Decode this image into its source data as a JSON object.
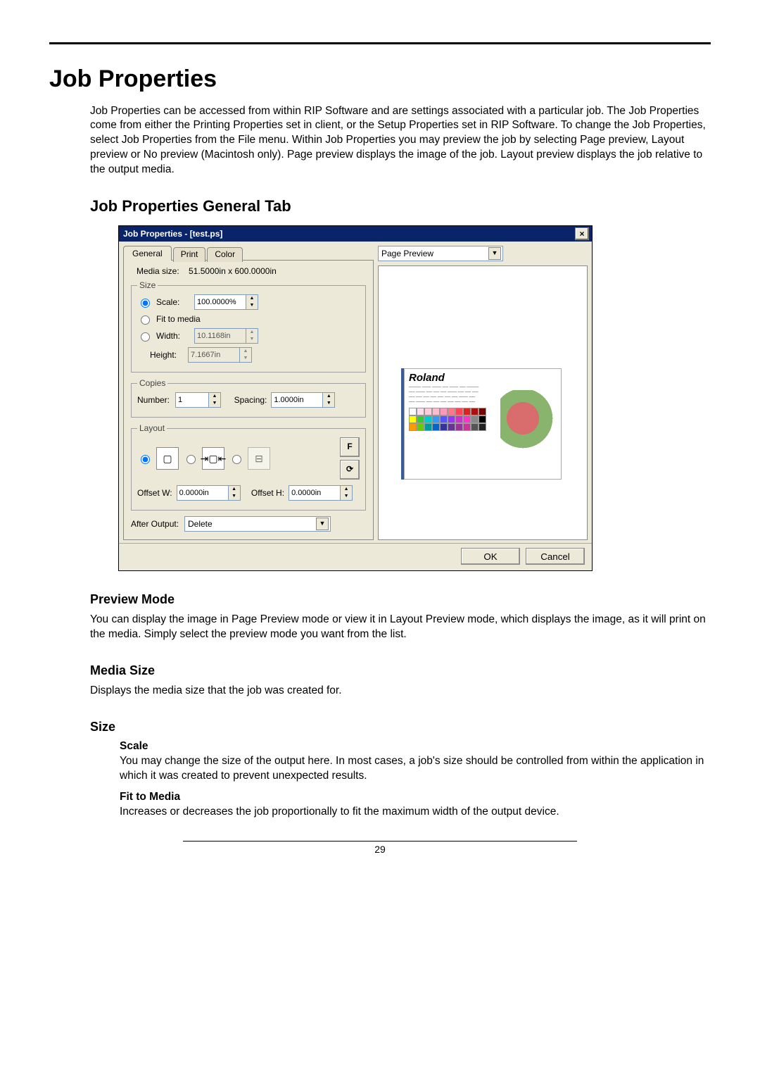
{
  "heading": "Job Properties",
  "intro": "Job Properties can be accessed from within RIP Software and are settings associated with a particular job. The Job Properties come from either the Printing Properties set in client, or the Setup Properties set in RIP Software. To change the Job Properties, select Job Properties from the File menu. Within Job Properties you may preview the job by selecting Page preview, Layout preview or No preview (Macintosh only). Page preview displays the image of the job. Layout preview displays the job relative to the output media.",
  "subheading": "Job Properties General Tab",
  "dialog": {
    "title": "Job Properties - [test.ps]",
    "tabs": [
      "General",
      "Print",
      "Color"
    ],
    "media_label": "Media size:",
    "media_value": "51.5000in x 600.0000in",
    "size_legend": "Size",
    "scale_label": "Scale:",
    "scale_value": "100.0000%",
    "fit_label": "Fit to media",
    "width_label": "Width:",
    "width_value": "10.1168in",
    "height_label": "Height:",
    "height_value": "7.1667in",
    "copies_legend": "Copies",
    "number_label": "Number:",
    "number_value": "1",
    "spacing_label": "Spacing:",
    "spacing_value": "1.0000in",
    "layout_legend": "Layout",
    "offsetw_label": "Offset W:",
    "offsetw_value": "0.0000in",
    "offseth_label": "Offset H:",
    "offseth_value": "0.0000in",
    "after_label": "After Output:",
    "after_value": "Delete",
    "f_label": "F",
    "preview_mode": "Page Preview",
    "brand": "Roland",
    "ok": "OK",
    "cancel": "Cancel"
  },
  "sections": {
    "preview_h": "Preview Mode",
    "preview_p": "You can display the image in Page Preview mode or view it in Layout Preview mode, which displays the image, as it will print on the media. Simply select the preview mode you want from the list.",
    "media_h": "Media Size",
    "media_p": "Displays the media size that the job was created for.",
    "size_h": "Size",
    "scale_h": "Scale",
    "scale_p": "You may change the size of the output here. In most cases, a job's size should be controlled from within the application in which it was created to prevent unexpected results.",
    "fit_h": "Fit to Media",
    "fit_p": "Increases or decreases the job proportionally to fit the maximum width of the output device."
  },
  "page_number": "29"
}
